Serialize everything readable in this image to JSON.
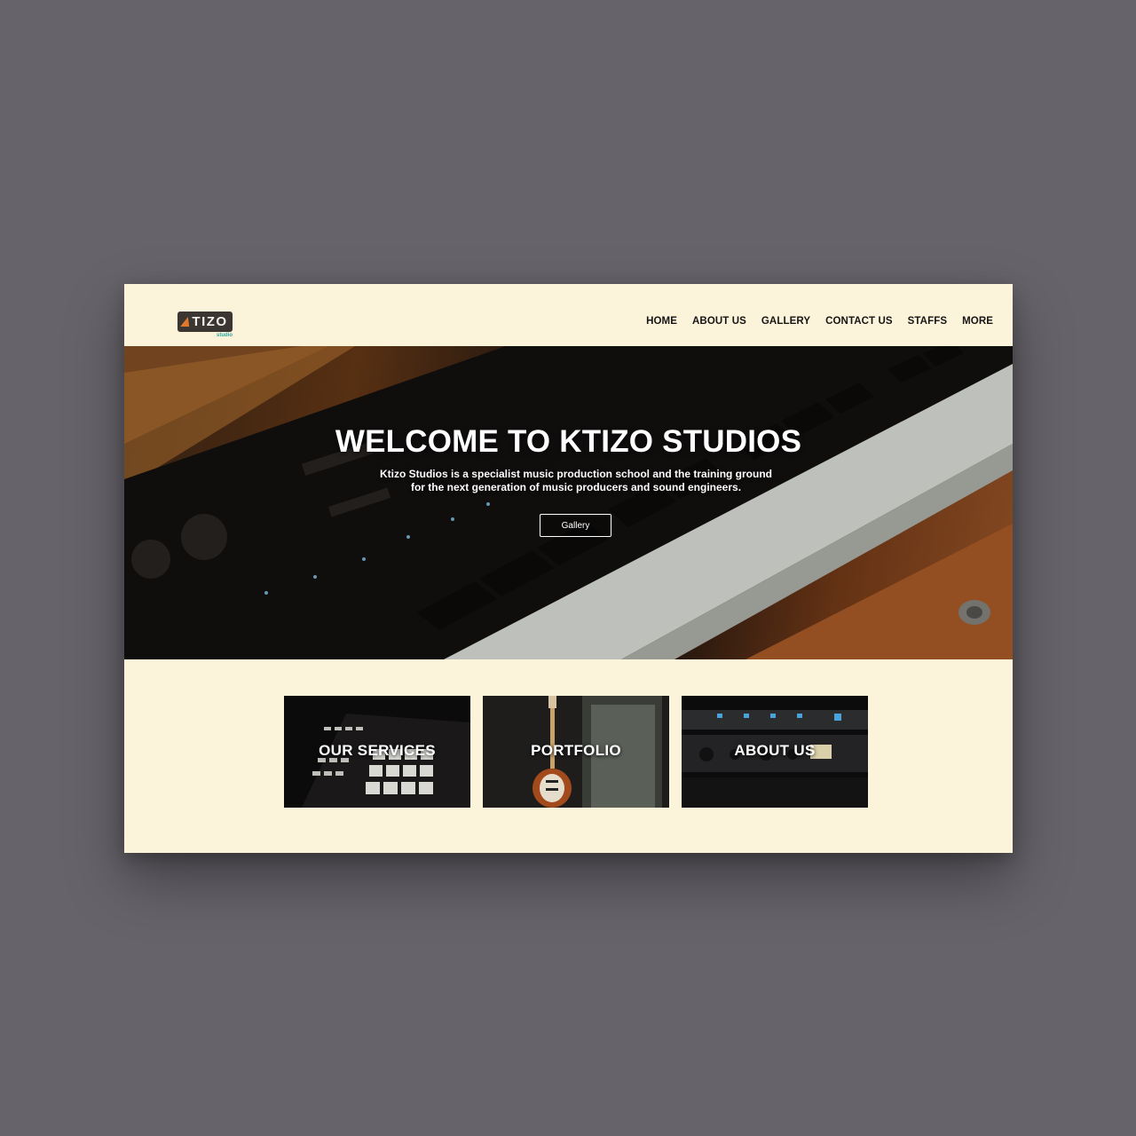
{
  "brand": {
    "logo_text": "TIZO",
    "logo_subtext": "studio",
    "accent": "#e2782c",
    "sub_accent": "#2aa7a2"
  },
  "nav": {
    "items": [
      "HOME",
      "ABOUT US",
      "GALLERY",
      "CONTACT US",
      "STAFFS",
      "MORE"
    ]
  },
  "hero": {
    "title": "WELCOME TO KTIZO STUDIOS",
    "text_line1": "Ktizo Studios is a specialist music production school and the training ground",
    "text_line2": "for the next generation of music producers and sound engineers.",
    "button_label": "Gallery"
  },
  "cards": [
    {
      "label": "OUR SERVICES"
    },
    {
      "label": "PORTFOLIO"
    },
    {
      "label": "ABOUT US"
    }
  ],
  "colors": {
    "page_bg": "#fbf3da",
    "outer_bg": "#66636a",
    "text_dark": "#161514"
  }
}
